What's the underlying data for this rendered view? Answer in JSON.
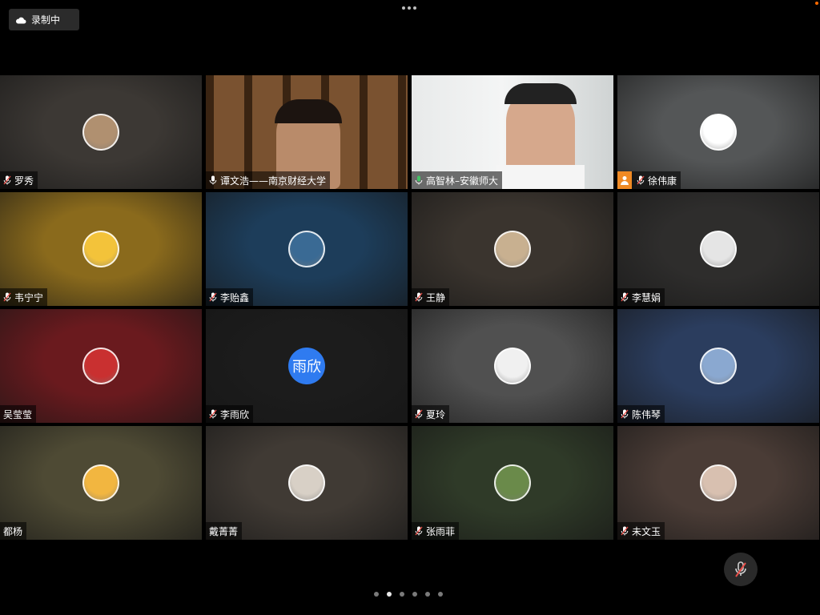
{
  "recording": {
    "label": "录制中"
  },
  "tiles": [
    {
      "name": "罗秀",
      "mic": "muted",
      "bg": "#3c3834",
      "avatar": "photo",
      "avatar_color": "#b09070"
    },
    {
      "name": "谭文浩——南京财经大学",
      "mic": "on",
      "bg": "#6b4a2a",
      "avatar": "video"
    },
    {
      "name": "高智林–安徽师大",
      "mic": "active",
      "bg": "#d9dcdc",
      "avatar": "video"
    },
    {
      "name": "徐伟康",
      "mic": "muted",
      "bg": "#545657",
      "avatar": "photo",
      "avatar_color": "#ffffff",
      "host": true
    },
    {
      "name": "韦宁宁",
      "mic": "muted",
      "bg": "#8a6a1c",
      "avatar": "photo",
      "avatar_color": "#f3c33a"
    },
    {
      "name": "李贻鑫",
      "mic": "muted",
      "bg": "#1d3d5a",
      "avatar": "photo",
      "avatar_color": "#3a6a94"
    },
    {
      "name": "王静",
      "mic": "muted",
      "bg": "#3a342e",
      "avatar": "photo",
      "avatar_color": "#c8b090"
    },
    {
      "name": "李慧娟",
      "mic": "muted",
      "bg": "#2e2d2c",
      "avatar": "photo",
      "avatar_color": "#e5e5e5"
    },
    {
      "name": "吴莹莹",
      "mic": "none",
      "bg": "#6a1a1e",
      "avatar": "photo",
      "avatar_color": "#c93030"
    },
    {
      "name": "李雨欣",
      "mic": "muted",
      "bg": "#1c1c1c",
      "avatar": "text",
      "avatar_text": "雨欣"
    },
    {
      "name": "夏玲",
      "mic": "muted",
      "bg": "#505050",
      "avatar": "photo",
      "avatar_color": "#f0f0f0"
    },
    {
      "name": "陈伟琴",
      "mic": "muted",
      "bg": "#2b3d5e",
      "avatar": "photo",
      "avatar_color": "#8aa8d0"
    },
    {
      "name": "都杨",
      "mic": "none",
      "bg": "#4e4a34",
      "avatar": "photo",
      "avatar_color": "#f2b640"
    },
    {
      "name": "戴菁菁",
      "mic": "none",
      "bg": "#403a34",
      "avatar": "photo",
      "avatar_color": "#d8d0c6"
    },
    {
      "name": "张雨菲",
      "mic": "muted",
      "bg": "#2f3a28",
      "avatar": "photo",
      "avatar_color": "#6a8a4a"
    },
    {
      "name": "未文玉",
      "mic": "muted",
      "bg": "#4a3c36",
      "avatar": "photo",
      "avatar_color": "#d8c0b0"
    }
  ],
  "pager": {
    "count": 6,
    "active": 1
  },
  "colors": {
    "active_speaker": "#43c165",
    "host": "#f08a24",
    "avatar_text_bg": "#2f7bf0",
    "record_dot": "#ff6a00"
  }
}
